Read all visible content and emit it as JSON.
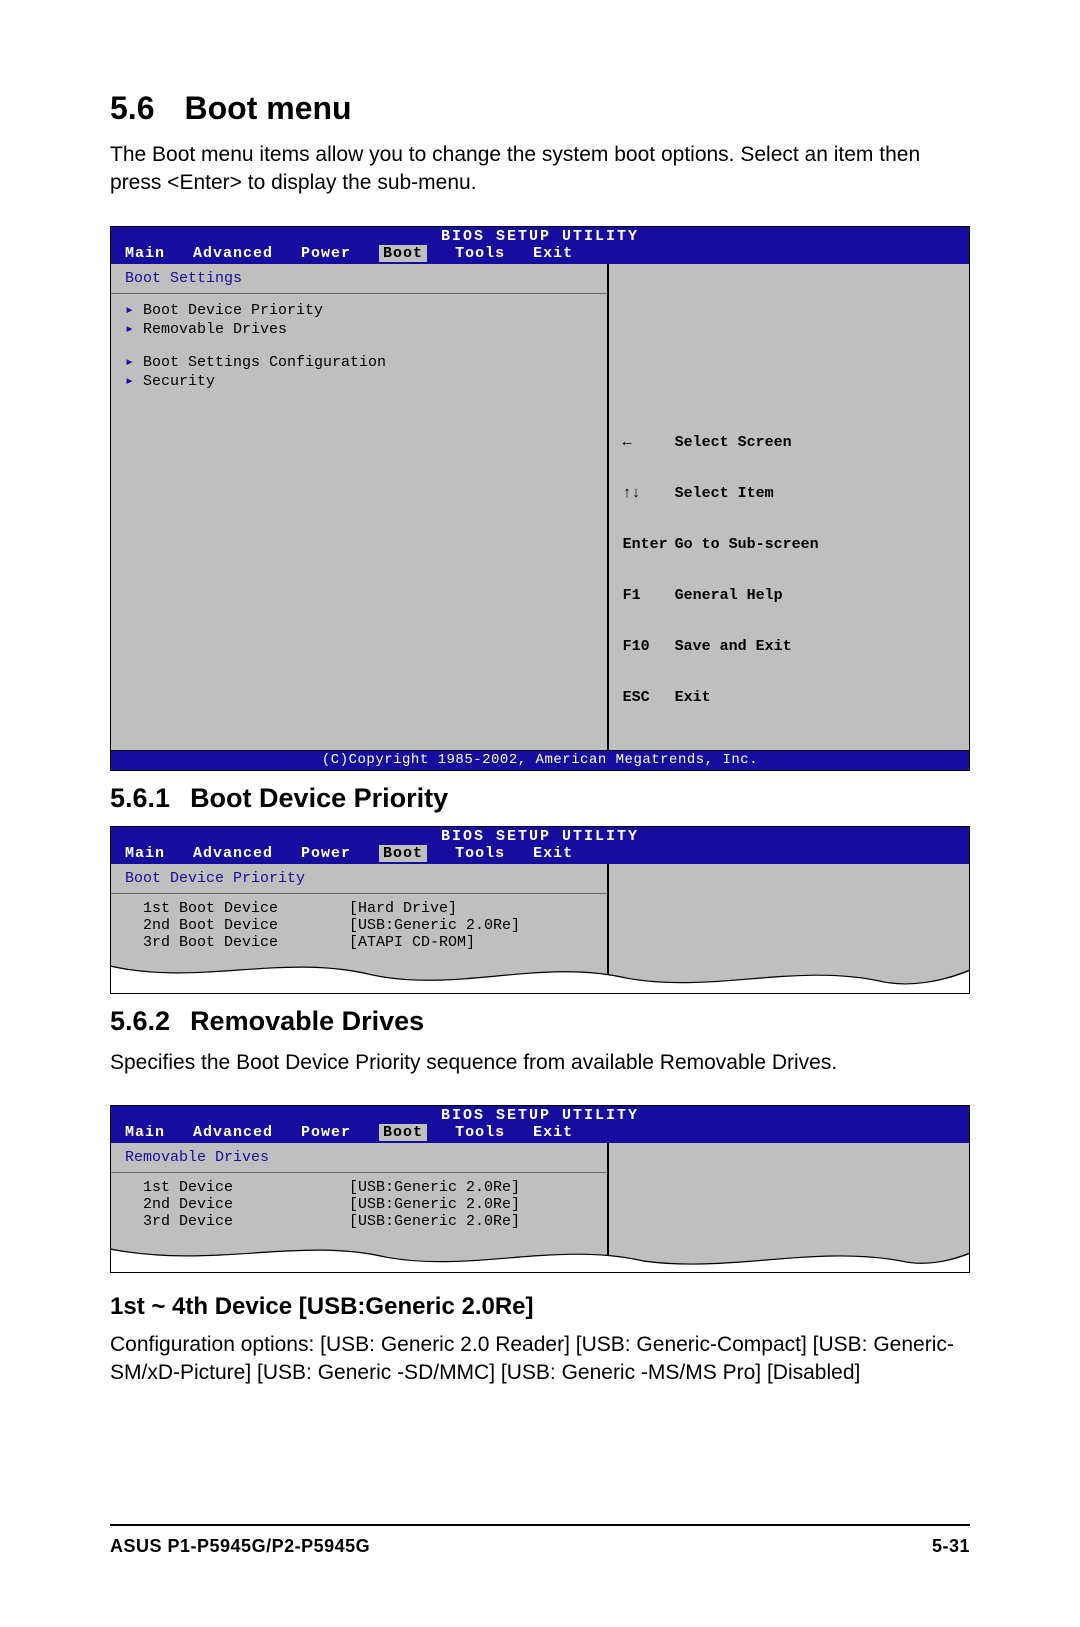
{
  "section": {
    "number": "5.6",
    "title": "Boot menu"
  },
  "intro": "The Boot menu items allow you to change the system boot options. Select an item then press <Enter> to display the sub-menu.",
  "bios_title": "BIOS SETUP UTILITY",
  "tabs": [
    "Main",
    "Advanced",
    "Power",
    "Boot",
    "Tools",
    "Exit"
  ],
  "bios1": {
    "heading": "Boot Settings",
    "group1": [
      "Boot Device Priority",
      "Removable Drives"
    ],
    "group2": [
      "Boot Settings Configuration",
      "Security"
    ],
    "help": [
      {
        "key": "←",
        "text": "Select Screen"
      },
      {
        "key": "↑↓",
        "text": "Select Item"
      },
      {
        "key": "Enter",
        "text": "Go to Sub-screen"
      },
      {
        "key": "F1",
        "text": "General Help"
      },
      {
        "key": "F10",
        "text": "Save and Exit"
      },
      {
        "key": "ESC",
        "text": "Exit"
      }
    ],
    "copyright": "(C)Copyright 1985-2002, American Megatrends, Inc."
  },
  "sub1": {
    "number": "5.6.1",
    "title": "Boot Device Priority"
  },
  "bios2": {
    "heading": "Boot Device Priority",
    "items": [
      {
        "label": "1st Boot Device",
        "value": "[Hard Drive]"
      },
      {
        "label": "2nd Boot Device",
        "value": "[USB:Generic 2.0Re]"
      },
      {
        "label": "3rd Boot Device",
        "value": "[ATAPI CD-ROM]"
      }
    ]
  },
  "sub2": {
    "number": "5.6.2",
    "title": "Removable Drives"
  },
  "sub2_text": "Specifies the Boot Device Priority sequence from available Removable Drives.",
  "bios3": {
    "heading": "Removable Drives",
    "items": [
      {
        "label": "1st Device",
        "value": "[USB:Generic 2.0Re]"
      },
      {
        "label": "2nd Device",
        "value": "[USB:Generic 2.0Re]"
      },
      {
        "label": "3rd Device",
        "value": "[USB:Generic 2.0Re]"
      }
    ]
  },
  "sub3": {
    "title": "1st ~ 4th Device [USB:Generic 2.0Re]"
  },
  "sub3_text": "Configuration options: [USB: Generic 2.0 Reader] [USB: Generic-Compact] [USB: Generic-SM/xD-Picture] [USB: Generic -SD/MMC] [USB: Generic -MS/MS Pro] [Disabled]",
  "footer_left": "ASUS P1-P5945G/P2-P5945G",
  "footer_right": "5-31"
}
